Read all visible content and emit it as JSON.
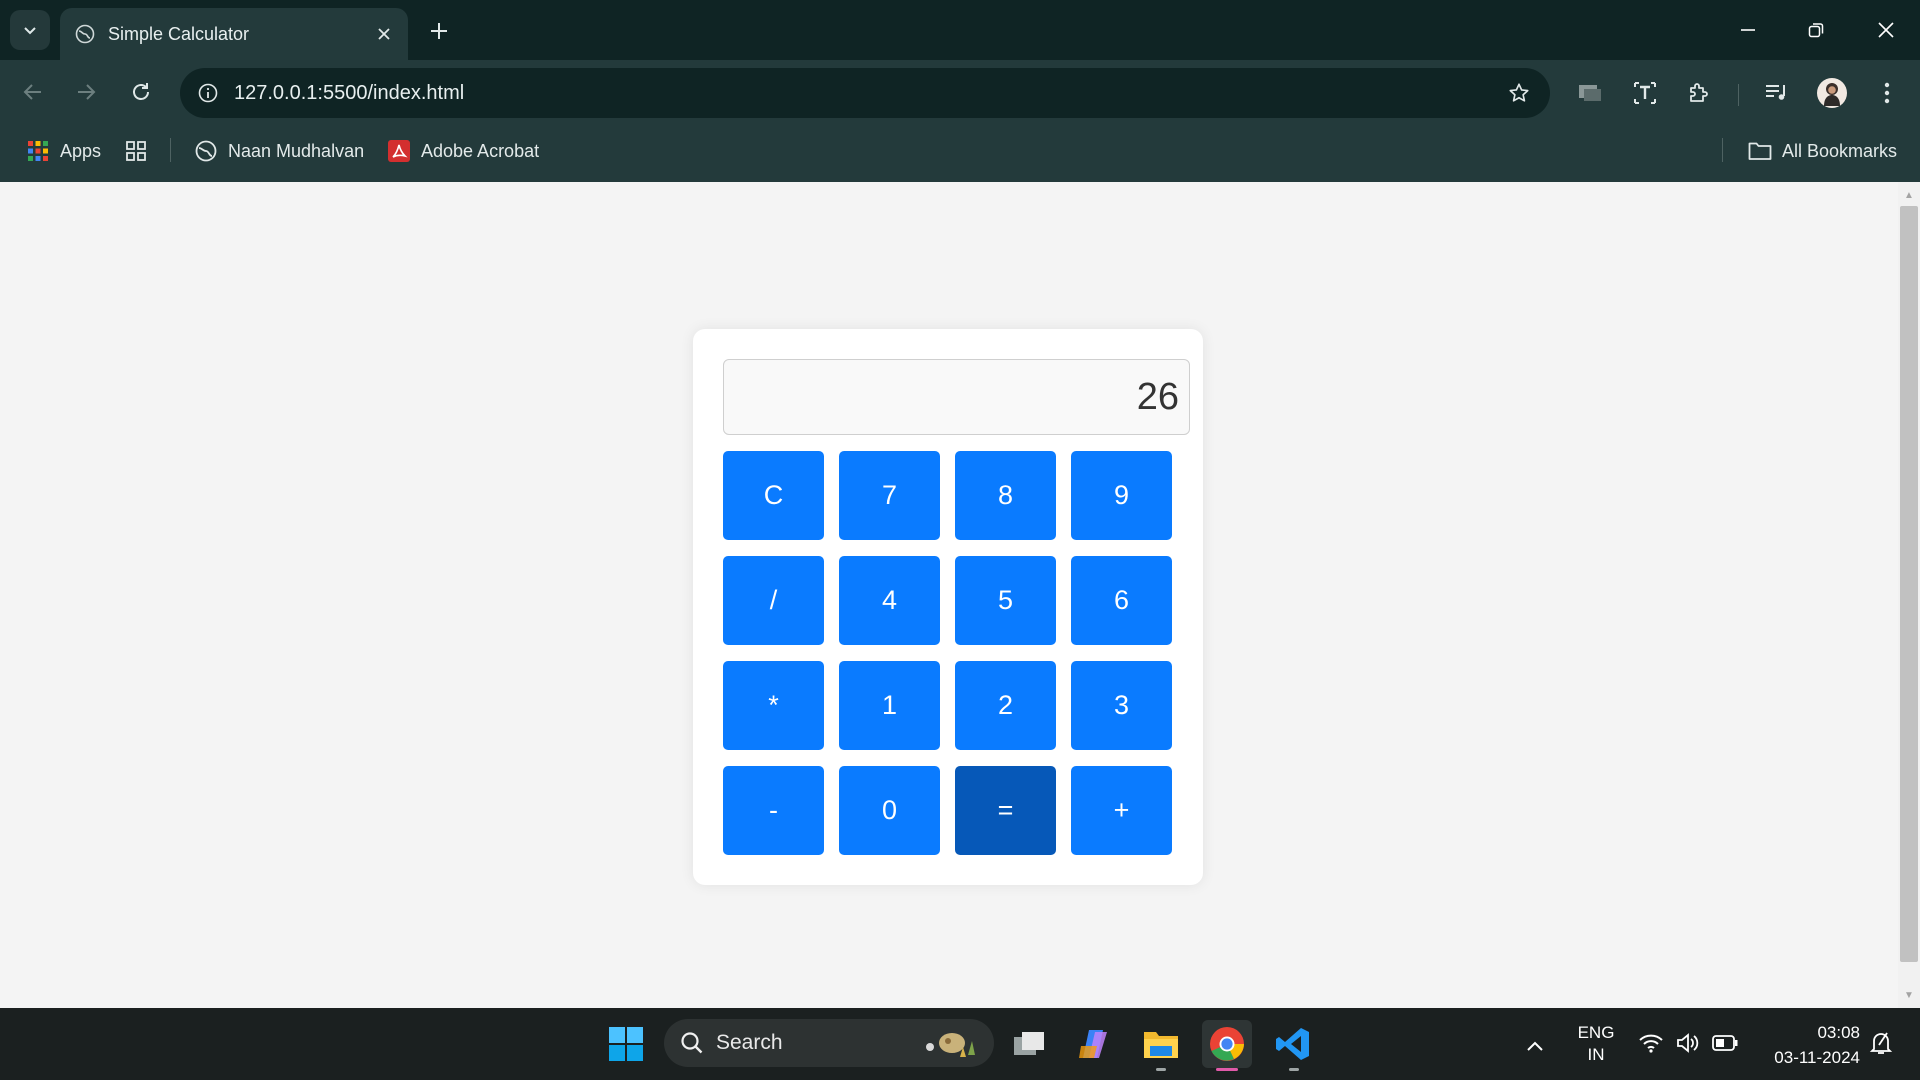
{
  "browser": {
    "tab_title": "Simple Calculator",
    "url": "127.0.0.1:5500/index.html"
  },
  "bookmarks": {
    "apps_label": "Apps",
    "items": [
      {
        "label": "Naan Mudhalvan",
        "icon": "globe-icon"
      },
      {
        "label": "Adobe Acrobat",
        "icon": "acrobat-icon"
      }
    ],
    "all_label": "All Bookmarks"
  },
  "calculator": {
    "display_value": "26",
    "keys": [
      "C",
      "7",
      "8",
      "9",
      "/",
      "4",
      "5",
      "6",
      "*",
      "1",
      "2",
      "3",
      "-",
      "0",
      "=",
      "+"
    ],
    "pressed_key": "="
  },
  "taskbar": {
    "search_label": "Search",
    "lang_top": "ENG",
    "lang_bottom": "IN",
    "time": "03:08",
    "date": "03-11-2024"
  },
  "colors": {
    "button": "#0a7bff",
    "button_pressed": "#0658b8",
    "chrome_dark": "#0f2424",
    "chrome_toolbar": "#233a3b"
  }
}
